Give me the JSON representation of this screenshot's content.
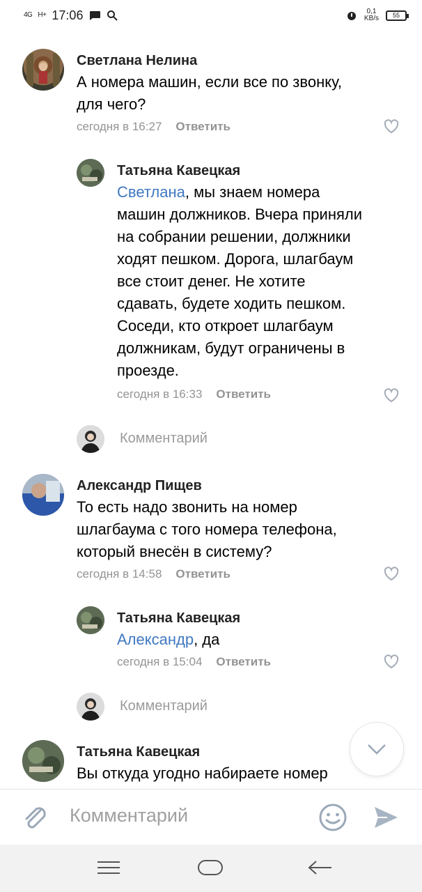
{
  "status_bar": {
    "signal_1": "4G",
    "signal_2": "H+",
    "time": "17:06",
    "speed": "0,1\nKB/s",
    "battery": "55"
  },
  "comments": [
    {
      "author": "Светлана Нелина",
      "text_lines": [
        "А номера машин, если все по звонку,",
        "для чего?"
      ],
      "time": "сегодня в 16:27",
      "reply_label": "Ответить"
    },
    {
      "author": "Татьяна Кавецкая",
      "mention": "Светлана",
      "text_first_rest": ", мы знаем номера",
      "text_lines": [
        "машин должников. Вчера приняли",
        "на собрании решении, должники",
        "ходят пешком. Дорога, шлагбаум",
        "все стоит денег. Не хотите",
        "сдавать, будете ходить пешком.",
        "Соседи, кто откроет шлагбаум",
        "должникам, будут ограничены в",
        "проезде."
      ],
      "time": "сегодня в 16:33",
      "reply_label": "Ответить"
    },
    {
      "author": "Александр Пищев",
      "text_lines": [
        "То есть надо звонить на номер",
        "шлагбаума с того номера телефона,",
        "который внесён в систему?"
      ],
      "time": "сегодня в 14:58",
      "reply_label": "Ответить"
    },
    {
      "author": "Татьяна Кавецкая",
      "mention": "Александр",
      "text_first_rest": ", да",
      "time": "сегодня в 15:04",
      "reply_label": "Ответить"
    },
    {
      "author": "Татьяна Кавецкая",
      "text_lines": [
        "Вы откуда угодно набираете номер"
      ]
    }
  ],
  "reply_placeholder": "Комментарий",
  "composer_placeholder": "Комментарий",
  "colors": {
    "mention": "#3f78c1",
    "meta": "#939393",
    "icon": "#9aa8b8",
    "send": "#a7b4c3"
  },
  "icons": [
    "attach-icon",
    "emoji-icon",
    "send-icon",
    "heart-icon",
    "chevron-down-icon",
    "menu-icon",
    "home-icon",
    "back-icon"
  ]
}
